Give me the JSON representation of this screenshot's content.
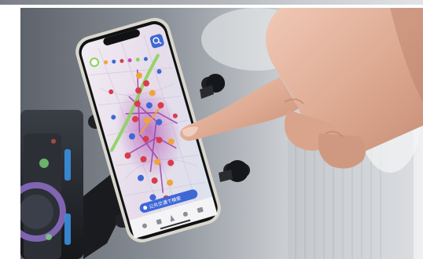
{
  "scene": {
    "subject": "hand-touching-smartphone-map",
    "colors": {
      "background_light": "#e6e8ea",
      "background_dark": "#5d626b",
      "phone_frame": "#d8d5cc",
      "map_base": "#e8e2ec",
      "map_accent": "#c44fb0",
      "route_green": "#8bd35a",
      "pin_red": "#d93c4b",
      "pin_blue": "#3f67d6",
      "skin": "#e2b39e",
      "mount_black": "#1e1f22"
    }
  },
  "phone_screen": {
    "search_button_icon": "search-icon",
    "bottom_bar_label": "公共交通で検索"
  }
}
